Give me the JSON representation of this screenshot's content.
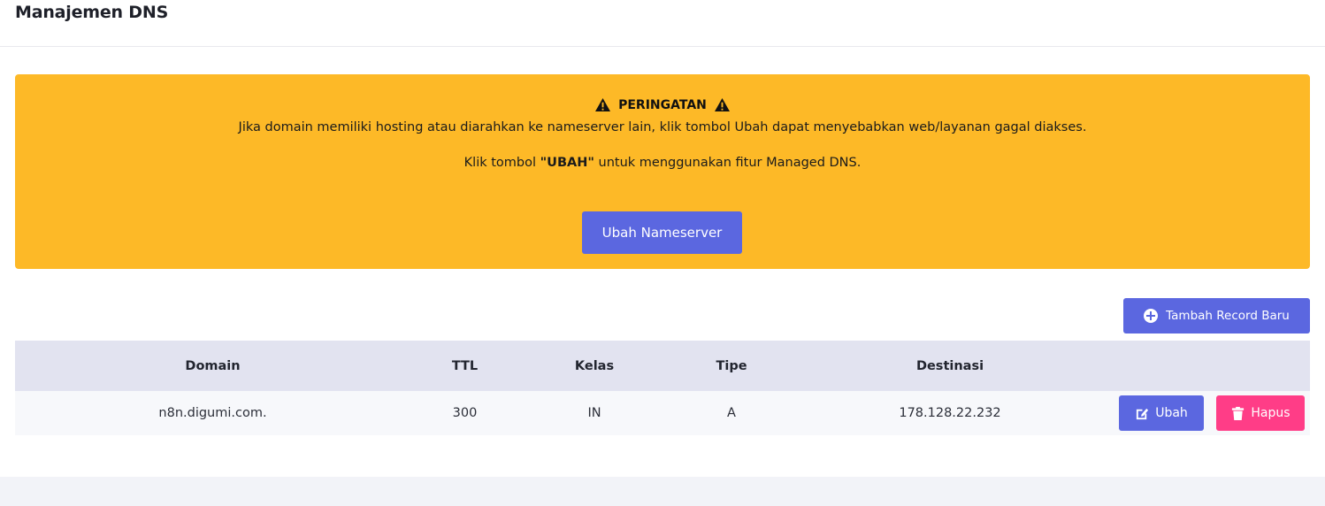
{
  "header": {
    "title": "Manajemen DNS"
  },
  "alert": {
    "title": "PERINGATAN",
    "line1": "Jika domain memiliki hosting atau diarahkan ke nameserver lain, klik tombol Ubah dapat menyebabkan web/layanan gagal diakses.",
    "line2_prefix": "Klik tombol ",
    "line2_bold": "\"UBAH\"",
    "line2_suffix": " untuk menggunakan fitur Managed DNS.",
    "button_label": "Ubah Nameserver",
    "background_color": "#fdb927",
    "icon": "warning-triangle-icon"
  },
  "toolbar": {
    "add_label": "Tambah Record Baru",
    "add_icon": "plus-circle-icon"
  },
  "table": {
    "columns": [
      "Domain",
      "TTL",
      "Kelas",
      "Tipe",
      "Destinasi",
      ""
    ],
    "rows": [
      {
        "domain": "n8n.digumi.com.",
        "ttl": "300",
        "kelas": "IN",
        "tipe": "A",
        "destinasi": "178.128.22.232"
      }
    ],
    "edit_label": "Ubah",
    "delete_label": "Hapus",
    "edit_icon": "edit-icon",
    "delete_icon": "trash-icon"
  },
  "colors": {
    "primary": "#5b67e0",
    "danger": "#ff3d87",
    "warning": "#fdb927",
    "table_header": "#e2e3f0"
  }
}
